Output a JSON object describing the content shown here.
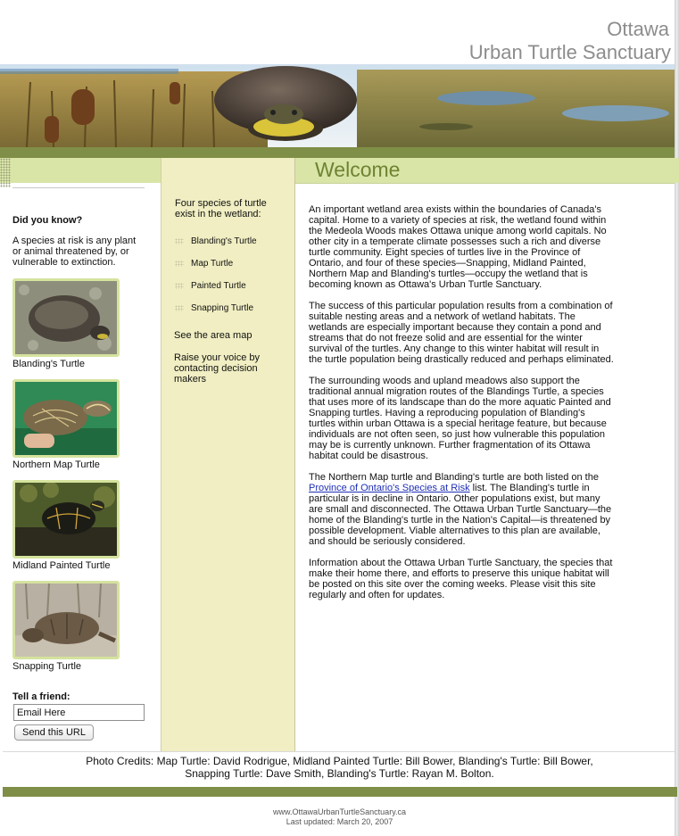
{
  "header": {
    "title_line1": "Ottawa",
    "title_line2": "Urban Turtle Sanctuary"
  },
  "welcome_heading": "Welcome",
  "sidebar_left": {
    "did_you_know": "Did you know?",
    "definition": "A species at risk is any plant or animal threatened by, or vulnerable to extinction.",
    "turtles": [
      {
        "caption": "Blanding's Turtle"
      },
      {
        "caption": "Northern Map Turtle"
      },
      {
        "caption": "Midland Painted Turtle"
      },
      {
        "caption": "Snapping Turtle"
      }
    ],
    "tell_a_friend": "Tell a friend:",
    "email_value": "Email Here",
    "send_button": "Send this URL"
  },
  "sidebar_mid": {
    "intro": "Four species of turtle exist in the wetland:",
    "species": [
      "Blanding's Turtle",
      "Map Turtle",
      "Painted Turtle",
      "Snapping Turtle"
    ],
    "area_map": "See the area map",
    "raise_voice": "Raise your voice by contacting decision makers"
  },
  "article": {
    "p1": "An important wetland area exists within the boundaries of Canada's capital. Home to a variety of species at risk, the wetland found within the Medeola Woods makes Ottawa unique among world capitals. No other city in a temperate climate possesses such a rich and diverse turtle community. Eight species of turtles live in the Province of Ontario, and four of these species—Snapping, Midland Painted, Northern Map and Blanding's turtles—occupy the wetland that is becoming known as Ottawa's Urban Turtle Sanctuary.",
    "p2": "The success of this particular population results from a combination of suitable nesting areas and a network of wetland habitats. The wetlands are especially important because they contain a pond and streams that do not freeze solid and are essential for the winter survival of the turtles. Any change to this winter habitat will result in the turtle population being drastically reduced and perhaps eliminated.",
    "p3": "The surrounding woods and upland meadows also support the traditional annual migration routes of the Blandings Turtle, a species that uses more of its landscape than do the more aquatic Painted and Snapping turtles. Having a reproducing population of Blanding's turtles within urban Ottawa is a special heritage feature, but because individuals are not often seen, so just how vulnerable this population may be is currently unknown. Further fragmentation of its Ottawa habitat could be disastrous.",
    "p4_before": "The Northern Map turtle and Blanding's turtle are both listed on the ",
    "p4_link": "Province of Ontario's Species at Risk",
    "p4_after": " list. The Blanding's turtle in particular is in decline in Ontario. Other populations exist, but many are small and disconnected. The Ottawa Urban Turtle Sanctuary—the home of the Blanding's turtle in the Nation's Capital—is threatened by possible development. Viable alternatives to this plan are available, and should be seriously considered.",
    "p5": "Information about the Ottawa Urban Turtle Sanctuary, the species that make their home there, and efforts to preserve this unique habitat will be posted on this site over the coming weeks. Please visit this site regularly and often for updates."
  },
  "footer": {
    "credits_line1": "Photo Credits: Map Turtle: David Rodrigue, Midland Painted Turtle: Bill Bower, Blanding's Turtle: Bill Bower,",
    "credits_line2": "Snapping Turtle: Dave Smith, Blanding's Turtle: Rayan M. Bolton.",
    "url": "www.OttawaUrbanTurtleSanctuary.ca",
    "updated": "Last updated: March 20, 2007"
  },
  "colors": {
    "olive_band": "#7f8f47",
    "light_band": "#d9e5a7",
    "mid_column": "#f0eec2",
    "welcome_text": "#6f8333",
    "link": "#1f2fb5"
  }
}
